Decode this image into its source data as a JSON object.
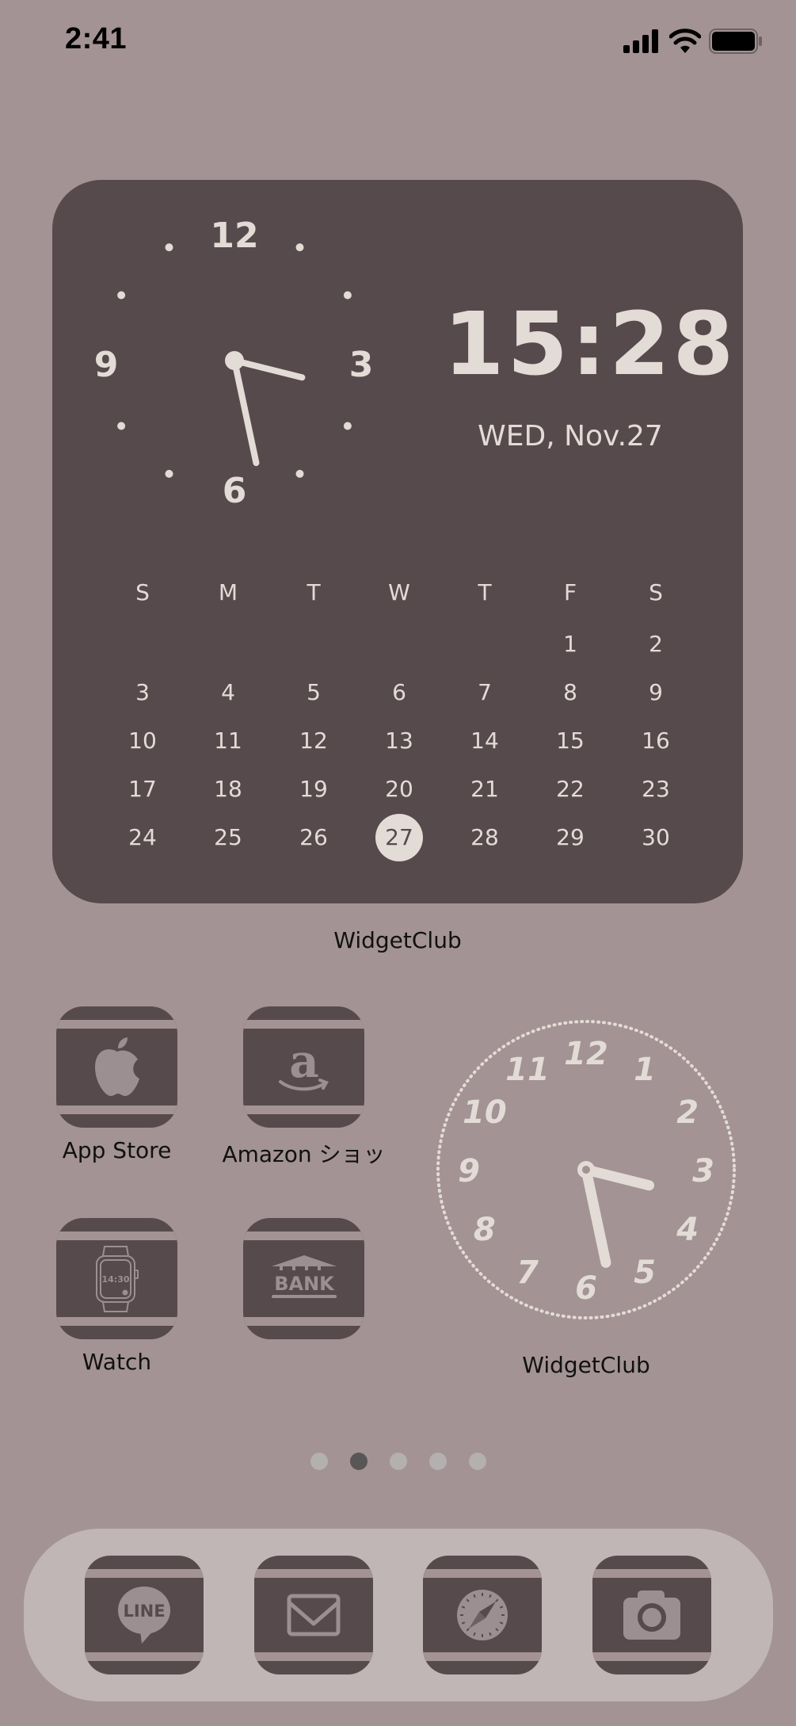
{
  "status_bar": {
    "time": "2:41",
    "icons": [
      "cellular-signal-icon",
      "wifi-icon",
      "battery-icon"
    ]
  },
  "big_widget": {
    "analog_clock": {
      "numerals": [
        "12",
        "3",
        "6",
        "9"
      ],
      "hour": 3,
      "minute": 28
    },
    "digital_time": "15:28",
    "date": "WED, Nov.27",
    "calendar": {
      "weekdays": [
        "S",
        "M",
        "T",
        "W",
        "T",
        "F",
        "S"
      ],
      "weeks": [
        [
          "",
          "",
          "",
          "",
          "",
          "1",
          "2"
        ],
        [
          "3",
          "4",
          "5",
          "6",
          "7",
          "8",
          "9"
        ],
        [
          "10",
          "11",
          "12",
          "13",
          "14",
          "15",
          "16"
        ],
        [
          "17",
          "18",
          "19",
          "20",
          "21",
          "22",
          "23"
        ],
        [
          "24",
          "25",
          "26",
          "27",
          "28",
          "29",
          "30"
        ]
      ],
      "today": "27"
    },
    "label": "WidgetClub"
  },
  "apps": [
    {
      "label": "App Store",
      "icon": "apple-logo-icon"
    },
    {
      "label": "Amazon ショッ",
      "icon": "amazon-logo-icon"
    },
    {
      "label": "Watch",
      "icon": "smartwatch-icon",
      "watch_face_text": "14:30"
    },
    {
      "label": "",
      "icon": "bank-icon",
      "icon_text": "BANK"
    }
  ],
  "small_clock_widget": {
    "numerals": [
      "12",
      "1",
      "2",
      "3",
      "4",
      "5",
      "6",
      "7",
      "8",
      "9",
      "10",
      "11"
    ],
    "hour": 3,
    "minute": 28,
    "label": "WidgetClub"
  },
  "page_indicator": {
    "total": 5,
    "active_index": 1
  },
  "dock": [
    {
      "app": "LINE",
      "icon": "line-chat-icon",
      "icon_text": "LINE"
    },
    {
      "app": "Mail",
      "icon": "mail-envelope-icon"
    },
    {
      "app": "Safari",
      "icon": "compass-icon"
    },
    {
      "app": "Camera",
      "icon": "camera-icon"
    }
  ],
  "colors": {
    "wallpaper": "#a39394",
    "widget_bg": "#574a4d",
    "cream": "#e3dcd6",
    "dock_bg": "#bfb6b5",
    "icon_glyph": "#9b8f91"
  }
}
